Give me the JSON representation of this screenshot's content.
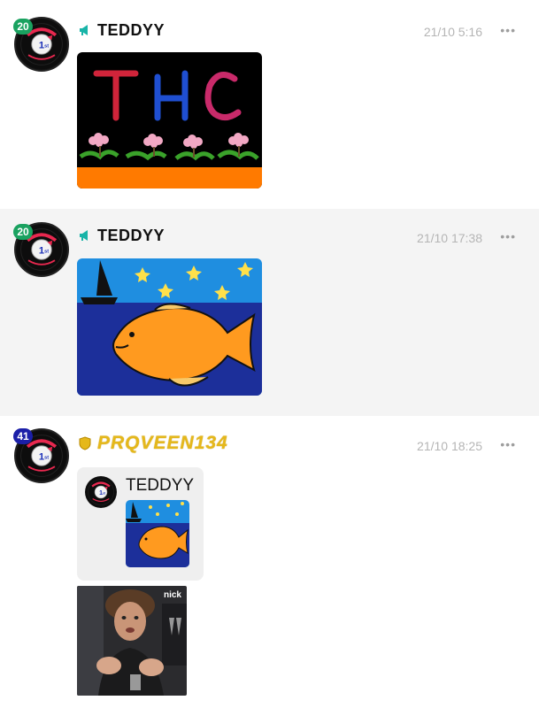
{
  "posts": [
    {
      "level": "20",
      "username": "TEDDYY",
      "timestamp": "21/10 5:16",
      "more_label": "•••",
      "role_icon": "megaphone-icon",
      "image": "drawing-thc-flowers",
      "image_text": "THC"
    },
    {
      "level": "20",
      "username": "TEDDYY",
      "timestamp": "21/10 17:38",
      "more_label": "•••",
      "role_icon": "megaphone-icon",
      "image": "drawing-fish"
    },
    {
      "level": "41",
      "username": "PRQVEEN134",
      "timestamp": "21/10 18:25",
      "more_label": "•••",
      "role_icon": "shield-icon",
      "quote": {
        "username": "TEDDYY",
        "image": "drawing-fish-thumbnail"
      },
      "gif": "person-clapping-gif",
      "gif_watermark": "nick"
    }
  ],
  "avatar": {
    "ring_text": "TAMIL HEART CHAT",
    "center_text": "1st",
    "bottom_text": "FRIENDS FOREVER"
  },
  "colors": {
    "level_green": "#1aa260",
    "level_blue": "#1b1fa8",
    "role_teal": "#18b4a8",
    "gold_name": "#e5b81b",
    "timestamp": "#b5b5b5"
  }
}
